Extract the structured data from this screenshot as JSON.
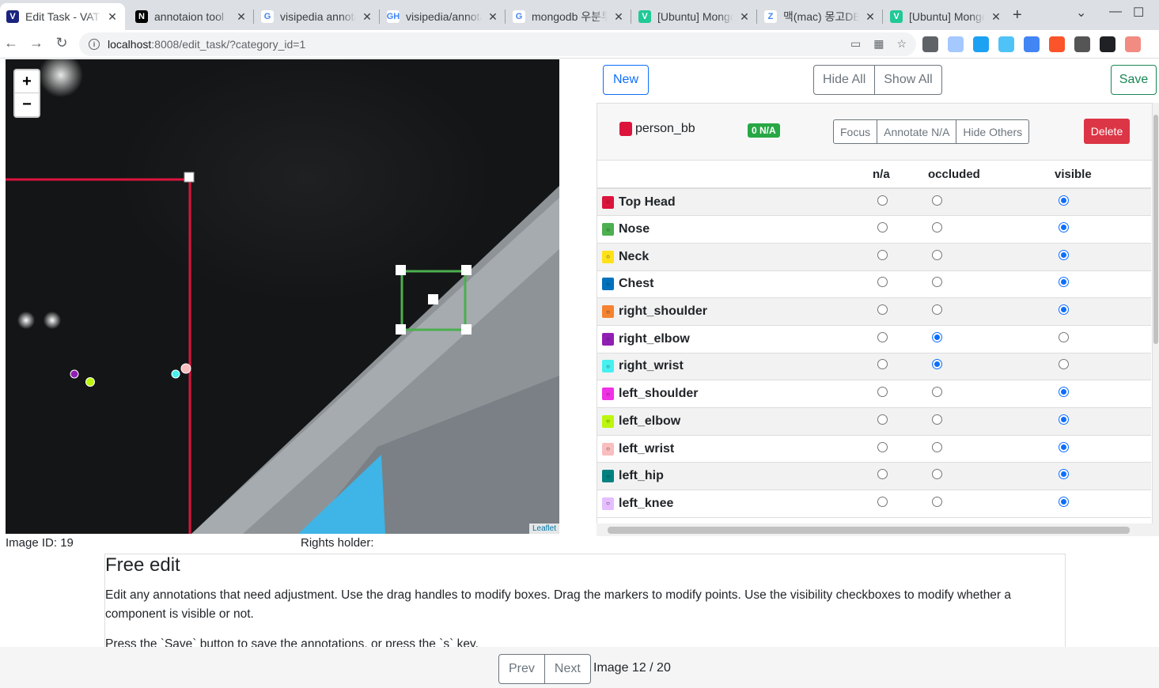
{
  "browser": {
    "tabs": [
      {
        "title": "Edit Task - VAT",
        "icon": "V",
        "icon_bg": "#1a237e",
        "active": true
      },
      {
        "title": "annotaion tool",
        "icon": "N",
        "icon_bg": "#000000"
      },
      {
        "title": "visipedia annotation",
        "icon": "G",
        "icon_bg": "#ffffff"
      },
      {
        "title": "visipedia/annotation",
        "icon": "GH",
        "icon_bg": "#ffffff"
      },
      {
        "title": "mongodb 우분투",
        "icon": "G",
        "icon_bg": "#ffffff"
      },
      {
        "title": "[Ubuntu] Mongo",
        "icon": "V",
        "icon_bg": "#20c997"
      },
      {
        "title": "맥(mac) 몽고DB",
        "icon": "Z",
        "icon_bg": "#ffffff"
      },
      {
        "title": "[Ubuntu] Mongo",
        "icon": "V",
        "icon_bg": "#20c997"
      }
    ],
    "url_host": "localhost",
    "url_path": ":8008/edit_task/?category_id=1"
  },
  "map": {
    "zoom_in": "+",
    "zoom_out": "−",
    "attribution": "Leaflet"
  },
  "meta": {
    "image_id": "Image ID: 19",
    "rights_holder": "Rights holder:"
  },
  "toolbar": {
    "new_label": "New",
    "hide_all_label": "Hide All",
    "show_all_label": "Show All",
    "save_label": "Save"
  },
  "annotation": {
    "name": "person_bb",
    "color": "#dc143c",
    "na_badge": "0 N/A",
    "focus_label": "Focus",
    "annotate_na_label": "Annotate N/A",
    "hide_others_label": "Hide Others",
    "delete_label": "Delete"
  },
  "table": {
    "headers": [
      "",
      "n/a",
      "occluded",
      "visible"
    ],
    "rows": [
      {
        "name": "Top Head",
        "color": "#dc143c",
        "state": "visible"
      },
      {
        "name": "Nose",
        "color": "#4caf50",
        "state": "visible"
      },
      {
        "name": "Neck",
        "color": "#ffe119",
        "state": "visible"
      },
      {
        "name": "Chest",
        "color": "#0072bd",
        "state": "visible"
      },
      {
        "name": "right_shoulder",
        "color": "#f58231",
        "state": "visible"
      },
      {
        "name": "right_elbow",
        "color": "#911eb4",
        "state": "occluded"
      },
      {
        "name": "right_wrist",
        "color": "#46f0f0",
        "state": "occluded"
      },
      {
        "name": "left_shoulder",
        "color": "#f032e6",
        "state": "visible"
      },
      {
        "name": "left_elbow",
        "color": "#bcf60c",
        "state": "visible"
      },
      {
        "name": "left_wrist",
        "color": "#fabebe",
        "state": "visible"
      },
      {
        "name": "left_hip",
        "color": "#008080",
        "state": "visible"
      },
      {
        "name": "left_knee",
        "color": "#e6beff",
        "state": "visible"
      }
    ]
  },
  "instructions": {
    "title": "Free edit",
    "p1": "Edit any annotations that need adjustment. Use the drag handles to modify boxes. Drag the markers to modify points. Use the visibility checkboxes to modify whether a component is visible or not.",
    "p2": "Press the `Save` button to save the annotations, or press the `s` key."
  },
  "footer": {
    "prev_label": "Prev",
    "next_label": "Next",
    "counter": "Image 12 / 20"
  }
}
